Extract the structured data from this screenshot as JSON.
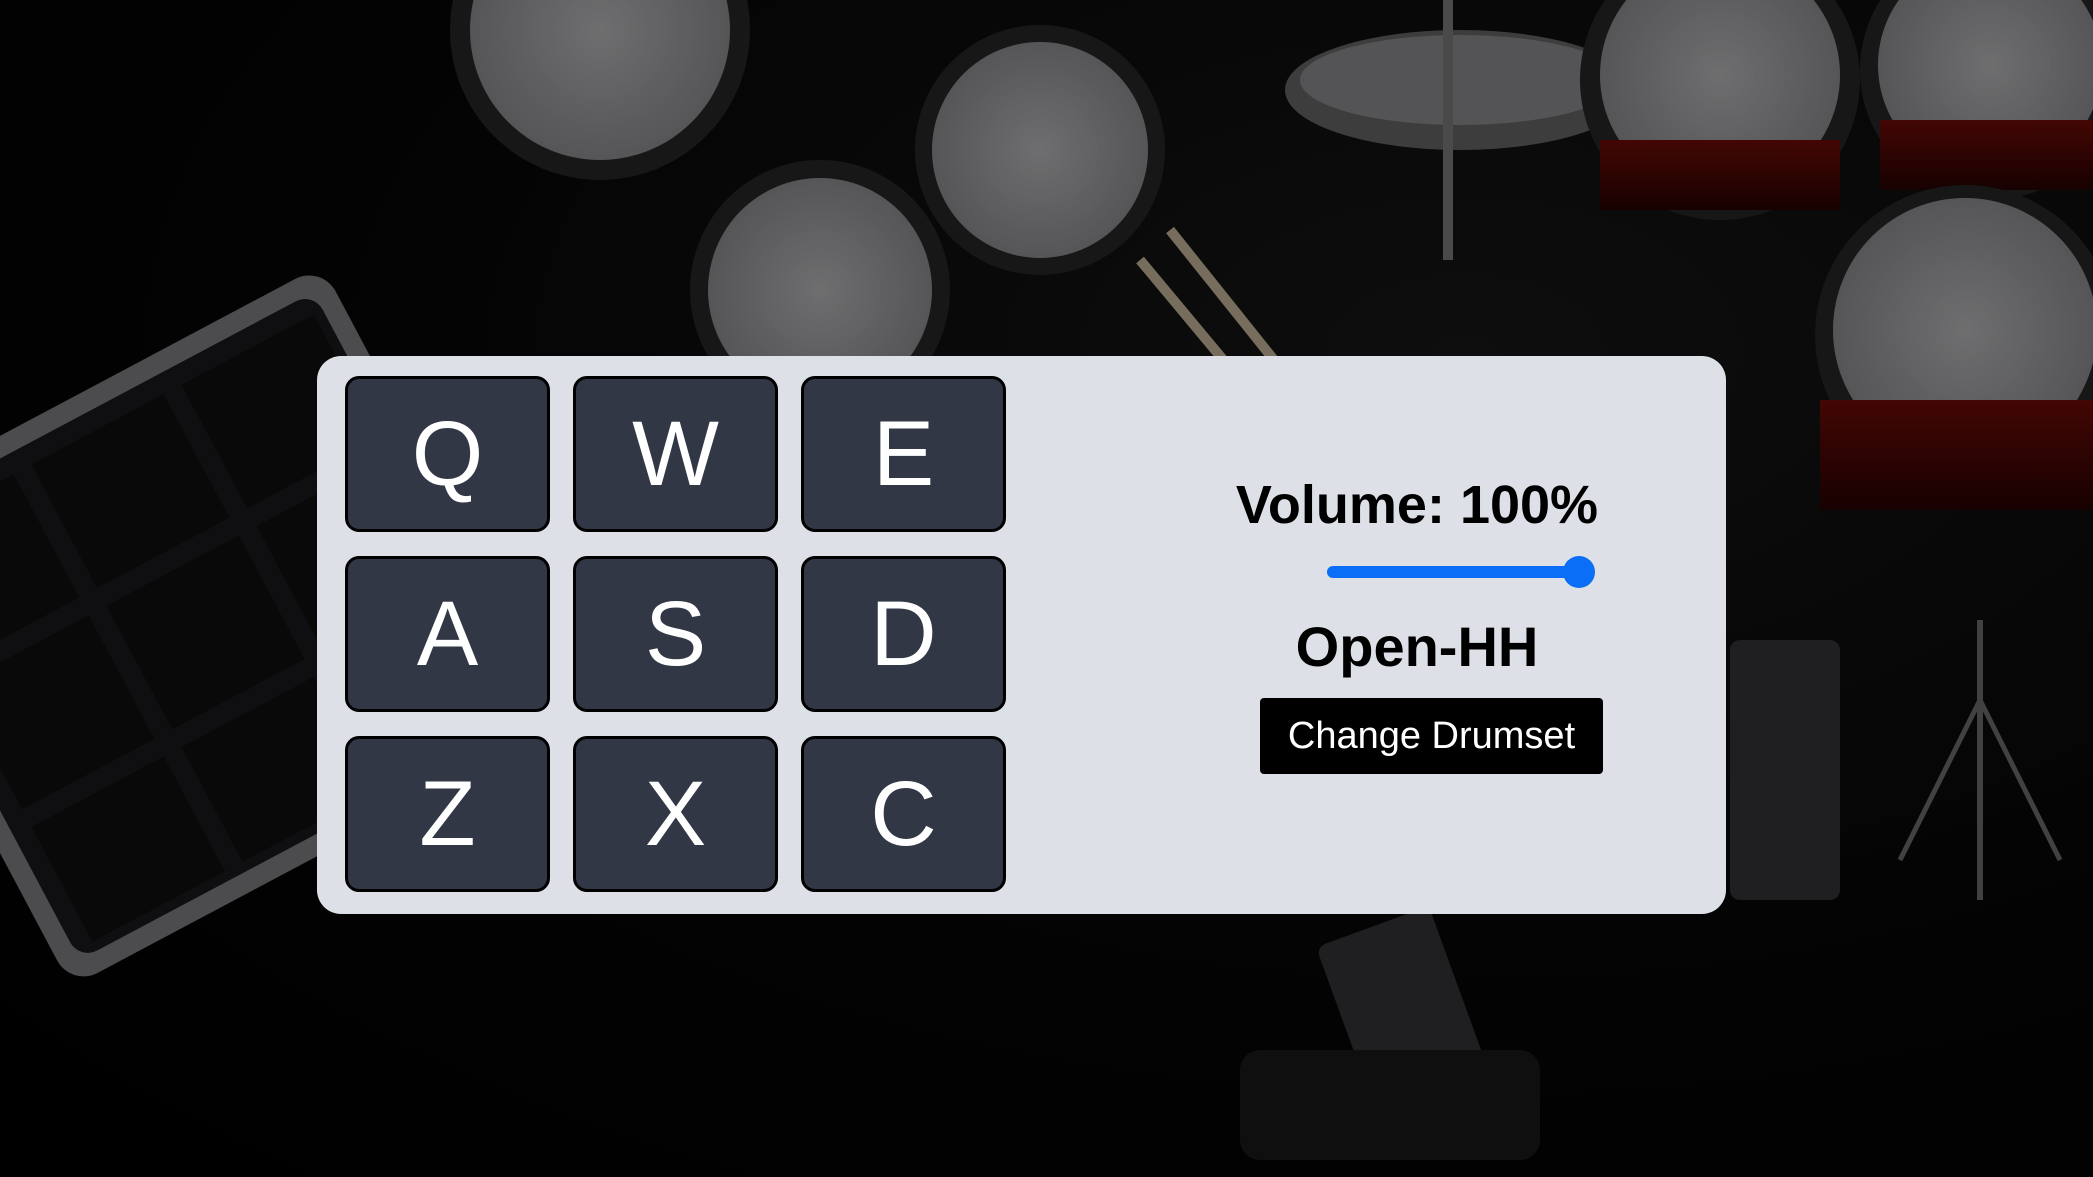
{
  "pads": [
    {
      "key": "Q"
    },
    {
      "key": "W"
    },
    {
      "key": "E"
    },
    {
      "key": "A"
    },
    {
      "key": "S"
    },
    {
      "key": "D"
    },
    {
      "key": "Z"
    },
    {
      "key": "X"
    },
    {
      "key": "C"
    }
  ],
  "controls": {
    "volume_label": "Volume: 100%",
    "volume_level": 1.0,
    "display_text": "Open-HH",
    "change_button_label": "Change Drumset"
  },
  "colors": {
    "panel": "#dde1e7",
    "pad": "#323746",
    "accent": "#0a6ef6",
    "button": "#000000"
  },
  "background": {
    "description_icon": "drum-kit-photo"
  }
}
